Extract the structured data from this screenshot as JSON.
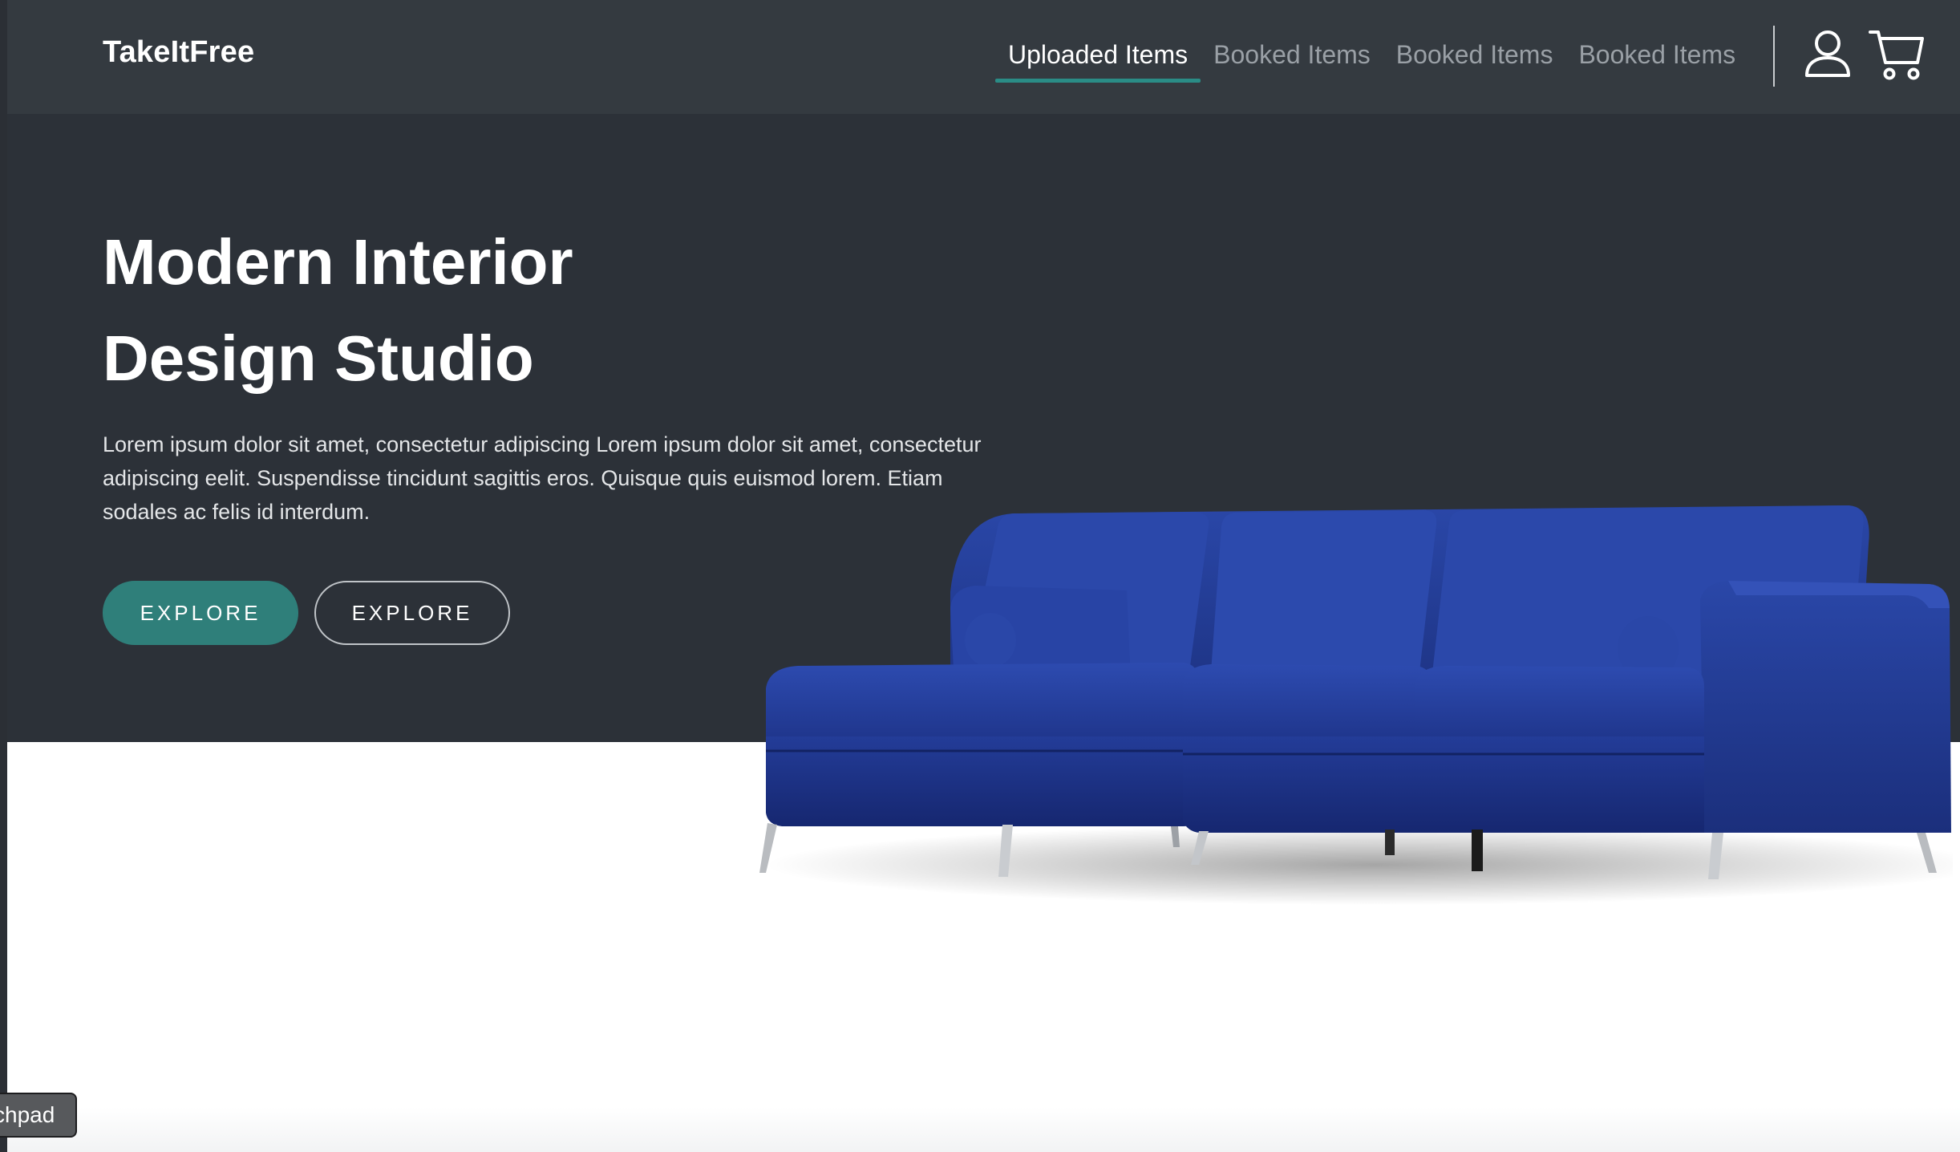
{
  "brand": {
    "name": "TakeItFree"
  },
  "nav": {
    "links": [
      {
        "label": "Uploaded Items",
        "active": true
      },
      {
        "label": "Booked Items",
        "active": false
      },
      {
        "label": "Booked Items",
        "active": false
      },
      {
        "label": "Booked Items",
        "active": false
      }
    ],
    "icons": [
      "user-icon",
      "cart-icon"
    ]
  },
  "hero": {
    "title_line1": "Modern Interior",
    "title_line2": "Design Studio",
    "text": "Lorem ipsum dolor sit amet, consectetur adipiscing Lorem ipsum dolor sit amet, consectetur adipiscing eelit. Suspendisse tincidunt sagittis eros. Quisque quis euismod lorem. Etiam sodales ac felis id interdum.",
    "primary_button": "EXPLORE",
    "secondary_button": "EXPLORE",
    "image": "blue-sectional-sofa"
  },
  "dock_tooltip": {
    "label": "chpad"
  },
  "colors": {
    "navbar_bg": "#343a40",
    "hero_bg": "#2c3138",
    "accent": "#2f7f7a",
    "sofa_blue": "#1f3a8a"
  }
}
